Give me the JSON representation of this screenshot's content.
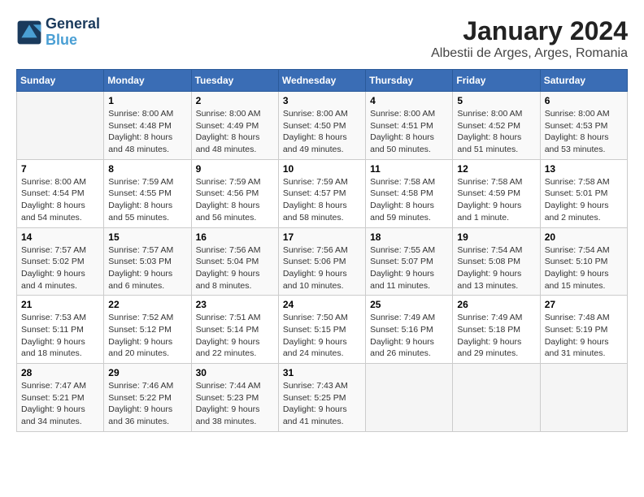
{
  "header": {
    "logo_line1": "General",
    "logo_line2": "Blue",
    "title": "January 2024",
    "subtitle": "Albestii de Arges, Arges, Romania"
  },
  "weekdays": [
    "Sunday",
    "Monday",
    "Tuesday",
    "Wednesday",
    "Thursday",
    "Friday",
    "Saturday"
  ],
  "weeks": [
    [
      {
        "day": "",
        "info": ""
      },
      {
        "day": "1",
        "info": "Sunrise: 8:00 AM\nSunset: 4:48 PM\nDaylight: 8 hours\nand 48 minutes."
      },
      {
        "day": "2",
        "info": "Sunrise: 8:00 AM\nSunset: 4:49 PM\nDaylight: 8 hours\nand 48 minutes."
      },
      {
        "day": "3",
        "info": "Sunrise: 8:00 AM\nSunset: 4:50 PM\nDaylight: 8 hours\nand 49 minutes."
      },
      {
        "day": "4",
        "info": "Sunrise: 8:00 AM\nSunset: 4:51 PM\nDaylight: 8 hours\nand 50 minutes."
      },
      {
        "day": "5",
        "info": "Sunrise: 8:00 AM\nSunset: 4:52 PM\nDaylight: 8 hours\nand 51 minutes."
      },
      {
        "day": "6",
        "info": "Sunrise: 8:00 AM\nSunset: 4:53 PM\nDaylight: 8 hours\nand 53 minutes."
      }
    ],
    [
      {
        "day": "7",
        "info": "Sunrise: 8:00 AM\nSunset: 4:54 PM\nDaylight: 8 hours\nand 54 minutes."
      },
      {
        "day": "8",
        "info": "Sunrise: 7:59 AM\nSunset: 4:55 PM\nDaylight: 8 hours\nand 55 minutes."
      },
      {
        "day": "9",
        "info": "Sunrise: 7:59 AM\nSunset: 4:56 PM\nDaylight: 8 hours\nand 56 minutes."
      },
      {
        "day": "10",
        "info": "Sunrise: 7:59 AM\nSunset: 4:57 PM\nDaylight: 8 hours\nand 58 minutes."
      },
      {
        "day": "11",
        "info": "Sunrise: 7:58 AM\nSunset: 4:58 PM\nDaylight: 8 hours\nand 59 minutes."
      },
      {
        "day": "12",
        "info": "Sunrise: 7:58 AM\nSunset: 4:59 PM\nDaylight: 9 hours\nand 1 minute."
      },
      {
        "day": "13",
        "info": "Sunrise: 7:58 AM\nSunset: 5:01 PM\nDaylight: 9 hours\nand 2 minutes."
      }
    ],
    [
      {
        "day": "14",
        "info": "Sunrise: 7:57 AM\nSunset: 5:02 PM\nDaylight: 9 hours\nand 4 minutes."
      },
      {
        "day": "15",
        "info": "Sunrise: 7:57 AM\nSunset: 5:03 PM\nDaylight: 9 hours\nand 6 minutes."
      },
      {
        "day": "16",
        "info": "Sunrise: 7:56 AM\nSunset: 5:04 PM\nDaylight: 9 hours\nand 8 minutes."
      },
      {
        "day": "17",
        "info": "Sunrise: 7:56 AM\nSunset: 5:06 PM\nDaylight: 9 hours\nand 10 minutes."
      },
      {
        "day": "18",
        "info": "Sunrise: 7:55 AM\nSunset: 5:07 PM\nDaylight: 9 hours\nand 11 minutes."
      },
      {
        "day": "19",
        "info": "Sunrise: 7:54 AM\nSunset: 5:08 PM\nDaylight: 9 hours\nand 13 minutes."
      },
      {
        "day": "20",
        "info": "Sunrise: 7:54 AM\nSunset: 5:10 PM\nDaylight: 9 hours\nand 15 minutes."
      }
    ],
    [
      {
        "day": "21",
        "info": "Sunrise: 7:53 AM\nSunset: 5:11 PM\nDaylight: 9 hours\nand 18 minutes."
      },
      {
        "day": "22",
        "info": "Sunrise: 7:52 AM\nSunset: 5:12 PM\nDaylight: 9 hours\nand 20 minutes."
      },
      {
        "day": "23",
        "info": "Sunrise: 7:51 AM\nSunset: 5:14 PM\nDaylight: 9 hours\nand 22 minutes."
      },
      {
        "day": "24",
        "info": "Sunrise: 7:50 AM\nSunset: 5:15 PM\nDaylight: 9 hours\nand 24 minutes."
      },
      {
        "day": "25",
        "info": "Sunrise: 7:49 AM\nSunset: 5:16 PM\nDaylight: 9 hours\nand 26 minutes."
      },
      {
        "day": "26",
        "info": "Sunrise: 7:49 AM\nSunset: 5:18 PM\nDaylight: 9 hours\nand 29 minutes."
      },
      {
        "day": "27",
        "info": "Sunrise: 7:48 AM\nSunset: 5:19 PM\nDaylight: 9 hours\nand 31 minutes."
      }
    ],
    [
      {
        "day": "28",
        "info": "Sunrise: 7:47 AM\nSunset: 5:21 PM\nDaylight: 9 hours\nand 34 minutes."
      },
      {
        "day": "29",
        "info": "Sunrise: 7:46 AM\nSunset: 5:22 PM\nDaylight: 9 hours\nand 36 minutes."
      },
      {
        "day": "30",
        "info": "Sunrise: 7:44 AM\nSunset: 5:23 PM\nDaylight: 9 hours\nand 38 minutes."
      },
      {
        "day": "31",
        "info": "Sunrise: 7:43 AM\nSunset: 5:25 PM\nDaylight: 9 hours\nand 41 minutes."
      },
      {
        "day": "",
        "info": ""
      },
      {
        "day": "",
        "info": ""
      },
      {
        "day": "",
        "info": ""
      }
    ]
  ]
}
